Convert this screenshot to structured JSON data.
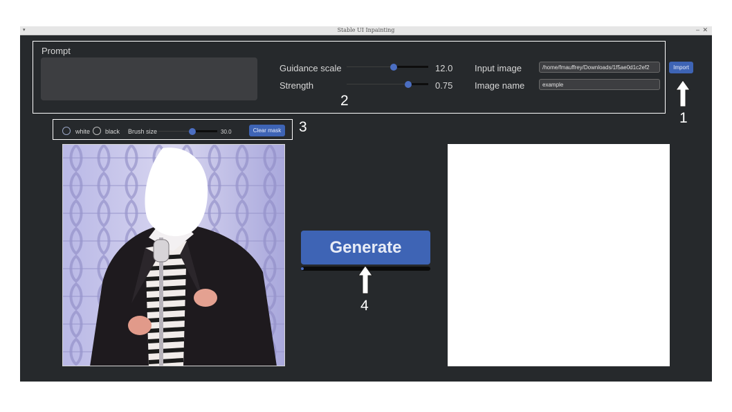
{
  "window": {
    "title": "Stable UI Inpainting"
  },
  "prompt": {
    "label": "Prompt",
    "value": ""
  },
  "guidance": {
    "label": "Guidance scale",
    "value": "12.0",
    "fraction": 0.58
  },
  "strength": {
    "label": "Strength",
    "value": "0.75",
    "fraction": 0.75
  },
  "input_image": {
    "label": "Input image",
    "value": "/home/fmauffrey/Downloads/1f5ae0d1c2ef2",
    "button": "Import"
  },
  "image_name": {
    "label": "Image name",
    "value": "example"
  },
  "mask_tools": {
    "white_label": "white",
    "black_label": "black",
    "brush_label": "Brush size",
    "brush_value": "30.0",
    "brush_fraction": 0.58,
    "clear_label": "Clear mask"
  },
  "generate": {
    "label": "Generate",
    "progress": 0.02
  },
  "annotations": {
    "n1": "1",
    "n2": "2",
    "n3": "3",
    "n4": "4"
  },
  "colors": {
    "accent": "#3e64b5",
    "background": "#26292c",
    "field": "#3d3e41"
  }
}
